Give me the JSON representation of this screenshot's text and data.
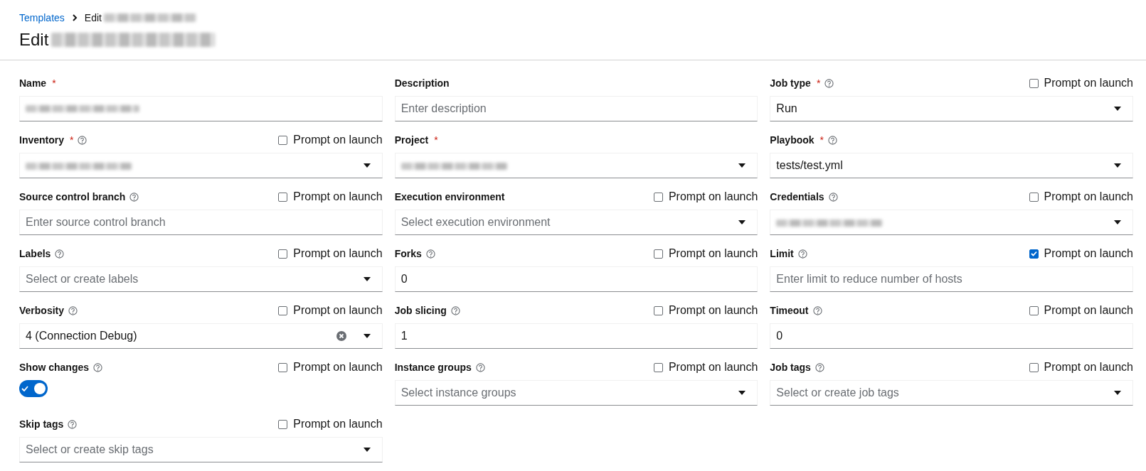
{
  "breadcrumb": [
    {
      "label": "Templates",
      "kind": "link",
      "redacted": false
    },
    {
      "label": "Edit",
      "kind": "current",
      "redacted": true
    }
  ],
  "title": {
    "text": "Edit",
    "redacted": true
  },
  "fields": [
    {
      "label": "Name",
      "required_mark": "*",
      "help": false,
      "control": {
        "kind": "text",
        "redacted": true
      }
    },
    {
      "label": "Description",
      "help": false,
      "control": {
        "kind": "text",
        "placeholder": "Enter description"
      }
    },
    {
      "label": "Job type",
      "required_mark": "*",
      "help": true,
      "prompt": {
        "label": "Prompt on launch",
        "checked": false
      },
      "control": {
        "kind": "select",
        "value": "Run"
      }
    },
    {
      "label": "Inventory",
      "required_mark": "*",
      "help": true,
      "prompt": {
        "label": "Prompt on launch",
        "checked": false
      },
      "control": {
        "kind": "select",
        "redacted": true
      }
    },
    {
      "label": "Project",
      "required_mark": "*",
      "help": false,
      "control": {
        "kind": "select",
        "redacted": true
      }
    },
    {
      "label": "Playbook",
      "required_mark": "*",
      "help": true,
      "control": {
        "kind": "select",
        "value": "tests/test.yml"
      }
    },
    {
      "label": "Source control branch",
      "help": true,
      "prompt": {
        "label": "Prompt on launch",
        "checked": false
      },
      "control": {
        "kind": "text",
        "placeholder": "Enter source control branch"
      }
    },
    {
      "label": "Execution environment",
      "help": false,
      "prompt": {
        "label": "Prompt on launch",
        "checked": false
      },
      "control": {
        "kind": "select",
        "placeholder": "Select execution environment"
      }
    },
    {
      "label": "Credentials",
      "help": true,
      "prompt": {
        "label": "Prompt on launch",
        "checked": false
      },
      "control": {
        "kind": "select",
        "redacted": true
      }
    },
    {
      "label": "Labels",
      "help": true,
      "prompt": {
        "label": "Prompt on launch",
        "checked": false
      },
      "control": {
        "kind": "select",
        "placeholder": "Select or create labels"
      }
    },
    {
      "label": "Forks",
      "help": true,
      "prompt": {
        "label": "Prompt on launch",
        "checked": false
      },
      "control": {
        "kind": "text",
        "value": "0"
      }
    },
    {
      "label": "Limit",
      "help": true,
      "prompt": {
        "label": "Prompt on launch",
        "checked": true
      },
      "control": {
        "kind": "text",
        "placeholder": "Enter limit to reduce number of hosts"
      }
    },
    {
      "label": "Verbosity",
      "help": true,
      "prompt": {
        "label": "Prompt on launch",
        "checked": false
      },
      "control": {
        "kind": "select",
        "value": "4 (Connection Debug)",
        "clearable": true
      }
    },
    {
      "label": "Job slicing",
      "help": true,
      "prompt": {
        "label": "Prompt on launch",
        "checked": false
      },
      "control": {
        "kind": "text",
        "value": "1"
      }
    },
    {
      "label": "Timeout",
      "help": true,
      "prompt": {
        "label": "Prompt on launch",
        "checked": false
      },
      "control": {
        "kind": "text",
        "value": "0"
      }
    },
    {
      "label": "Show changes",
      "help": true,
      "prompt": {
        "label": "Prompt on launch",
        "checked": false
      },
      "control": {
        "kind": "switch",
        "on": true
      }
    },
    {
      "label": "Instance groups",
      "help": true,
      "prompt": {
        "label": "Prompt on launch",
        "checked": false
      },
      "control": {
        "kind": "select",
        "placeholder": "Select instance groups"
      }
    },
    {
      "label": "Job tags",
      "help": true,
      "prompt": {
        "label": "Prompt on launch",
        "checked": false
      },
      "control": {
        "kind": "select",
        "placeholder": "Select or create job tags"
      }
    },
    {
      "label": "Skip tags",
      "help": true,
      "prompt": {
        "label": "Prompt on launch",
        "checked": false
      },
      "control": {
        "kind": "select",
        "placeholder": "Select or create skip tags"
      }
    }
  ]
}
